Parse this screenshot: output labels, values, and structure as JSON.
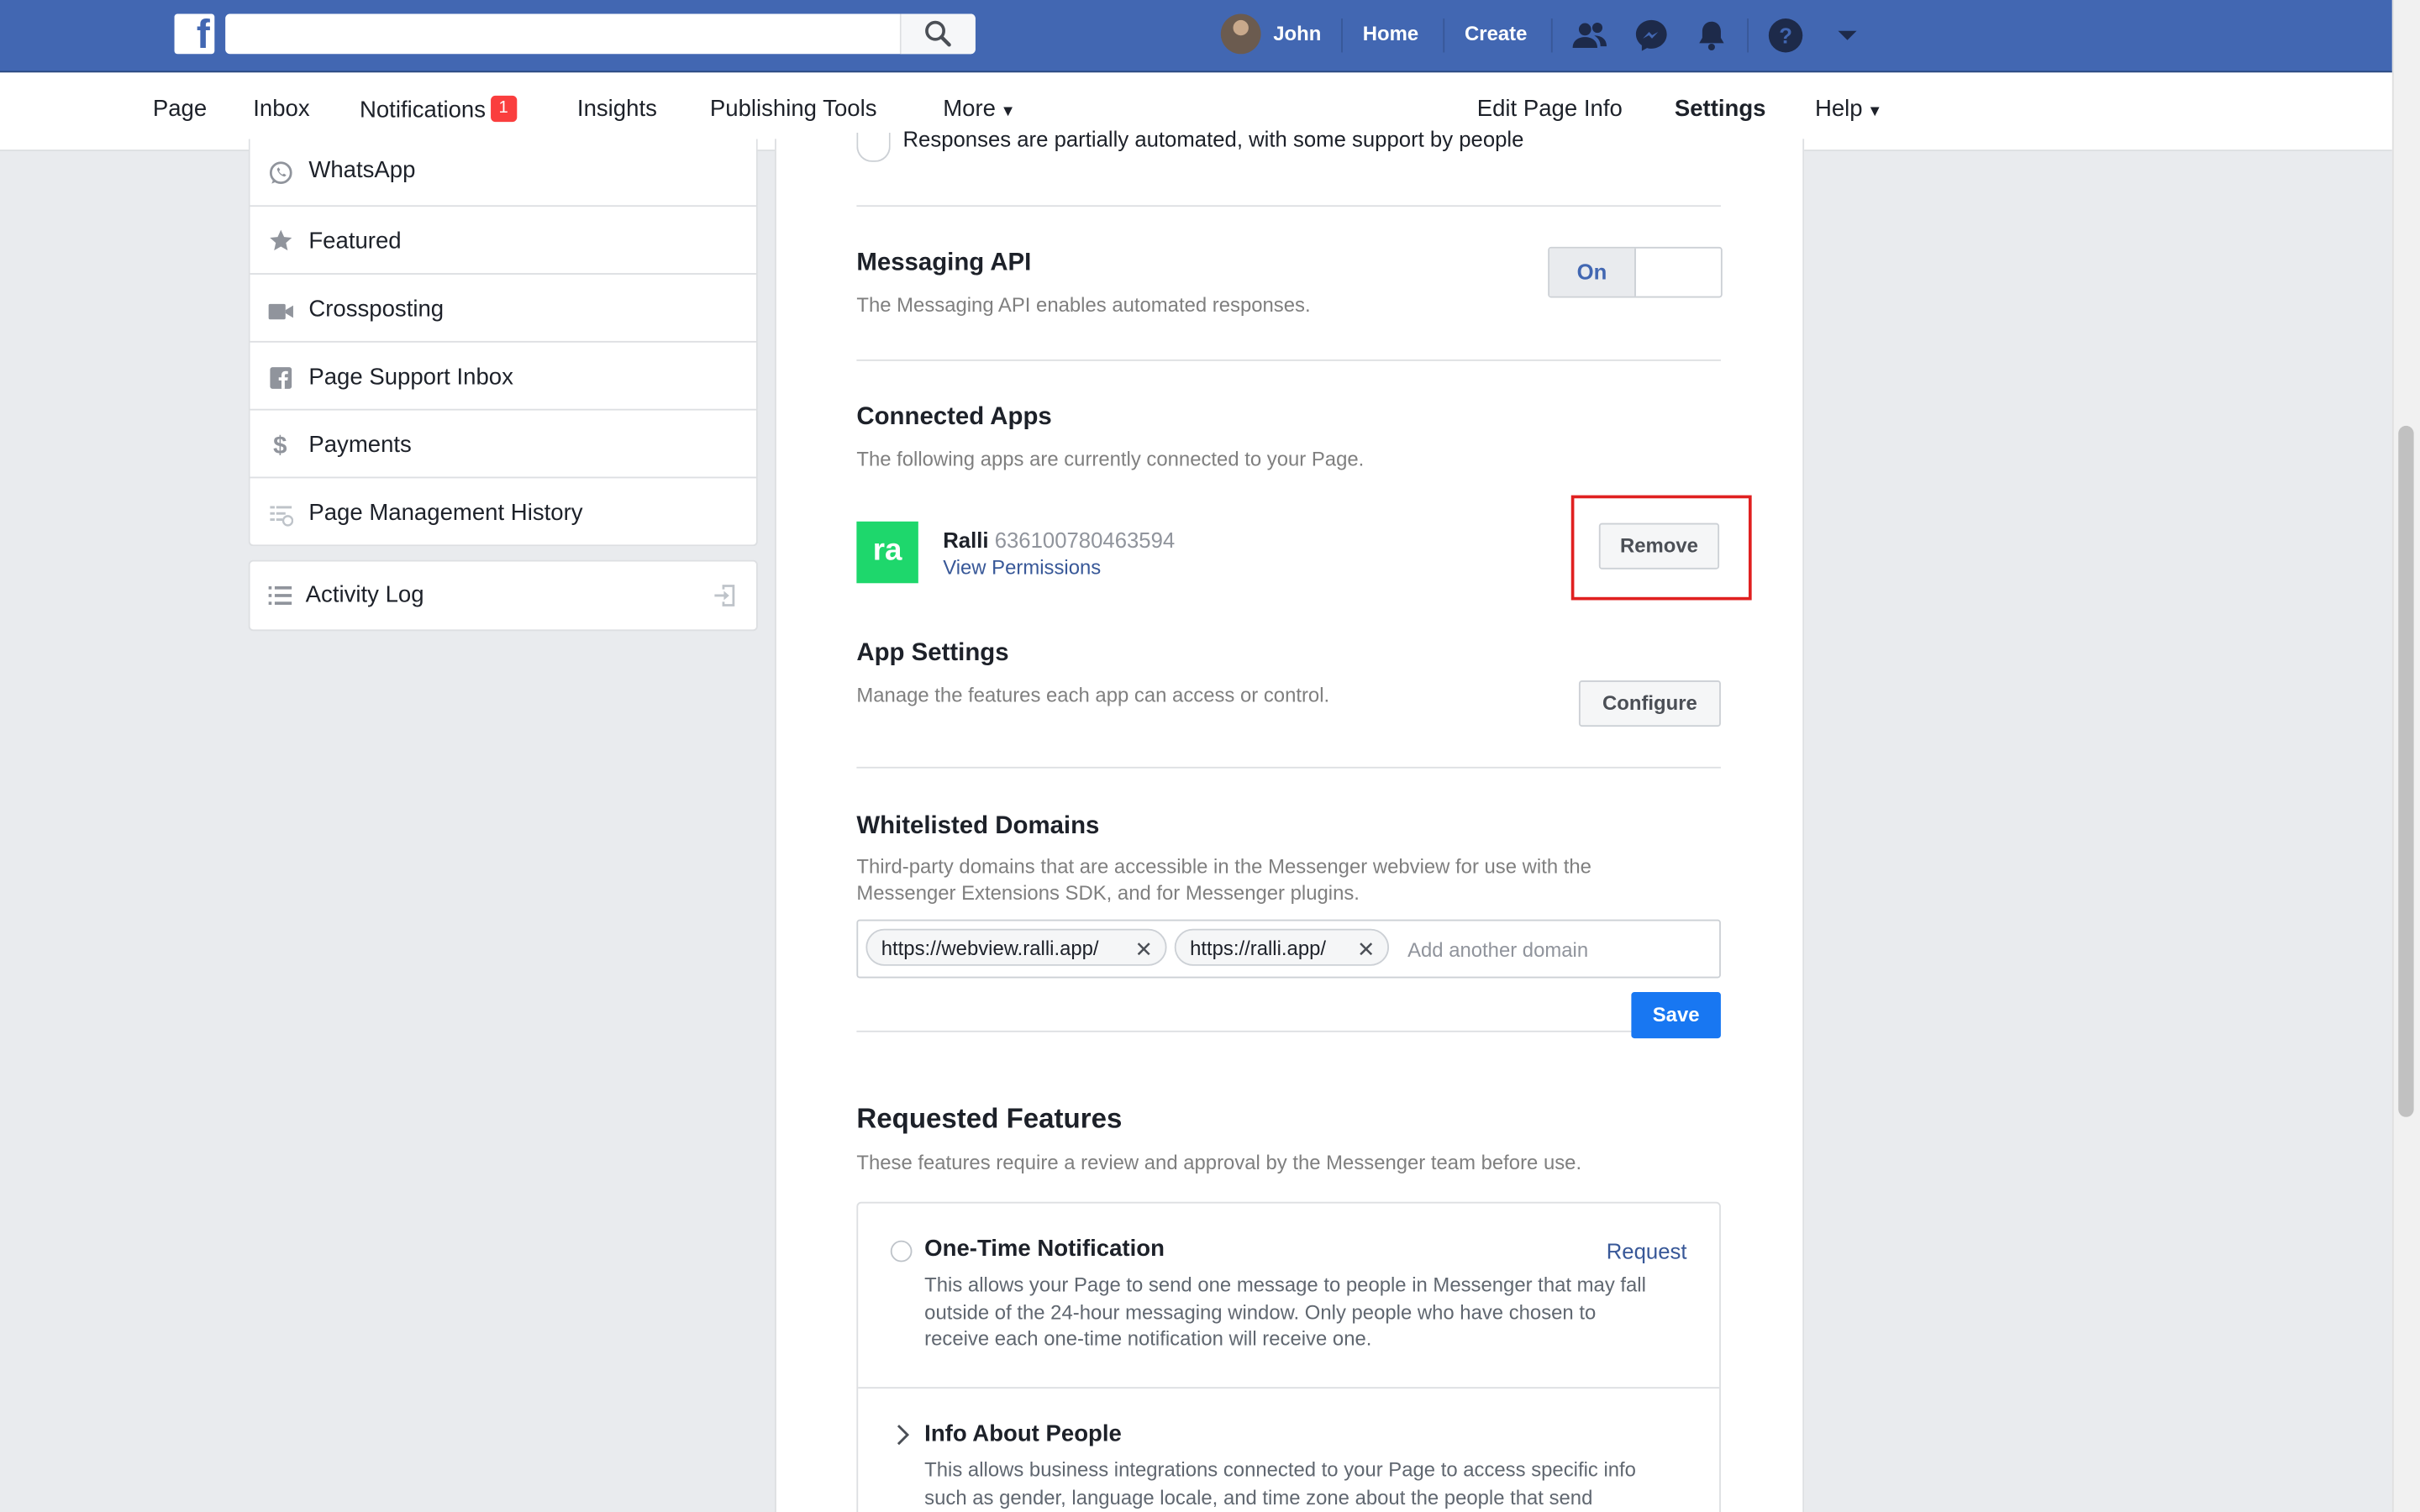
{
  "topbar": {
    "user_name": "John",
    "home_label": "Home",
    "create_label": "Create",
    "search_placeholder": ""
  },
  "pagenav": {
    "items": [
      "Page",
      "Inbox",
      "Notifications",
      "Insights",
      "Publishing Tools",
      "More"
    ],
    "notifications_badge": "1",
    "right_items": [
      "Edit Page Info",
      "Settings",
      "Help"
    ],
    "active": "Settings"
  },
  "sidebar": {
    "items": [
      {
        "label": "WhatsApp",
        "icon": "whatsapp-icon"
      },
      {
        "label": "Featured",
        "icon": "star-icon"
      },
      {
        "label": "Crossposting",
        "icon": "video-camera-icon"
      },
      {
        "label": "Page Support Inbox",
        "icon": "facebook-square-icon"
      },
      {
        "label": "Payments",
        "icon": "dollar-icon"
      },
      {
        "label": "Page Management History",
        "icon": "history-list-icon"
      }
    ],
    "activity_log": "Activity Log"
  },
  "main": {
    "partial_option": "Responses are partially automated, with some support by people",
    "messaging_api": {
      "title": "Messaging API",
      "desc": "The Messaging API enables automated responses.",
      "toggle_on_label": "On",
      "state": "on"
    },
    "connected_apps": {
      "title": "Connected Apps",
      "desc": "The following apps are currently connected to your Page.",
      "app_logo_text": "ra",
      "app_name": "Ralli",
      "app_id": "636100780463594",
      "view_permissions": "View Permissions",
      "remove_label": "Remove"
    },
    "app_settings": {
      "title": "App Settings",
      "desc": "Manage the features each app can access or control.",
      "configure_label": "Configure"
    },
    "whitelisted": {
      "title": "Whitelisted Domains",
      "desc": "Third-party domains that are accessible in the Messenger webview for use with the Messenger Extensions SDK, and for Messenger plugins.",
      "domains": [
        "https://webview.ralli.app/",
        "https://ralli.app/"
      ],
      "placeholder": "Add another domain",
      "save_label": "Save"
    },
    "requested_features": {
      "title": "Requested Features",
      "desc": "These features require a review and approval by the Messenger team before use.",
      "features": [
        {
          "title": "One-Time Notification",
          "desc": "This allows your Page to send one message to people in Messenger that may fall outside of the 24-hour messaging window. Only people who have chosen to receive each one-time notification will receive one.",
          "action": "Request"
        },
        {
          "title": "Info About People",
          "desc": "This allows business integrations connected to your Page to access specific info such as gender, language locale, and time zone about the people that send"
        }
      ]
    }
  },
  "colors": {
    "brand_blue": "#4267b2",
    "save_blue": "#1877f2",
    "app_green": "#1ed76c",
    "highlight_red": "#e02020",
    "badge_red": "#fa3e3e"
  }
}
